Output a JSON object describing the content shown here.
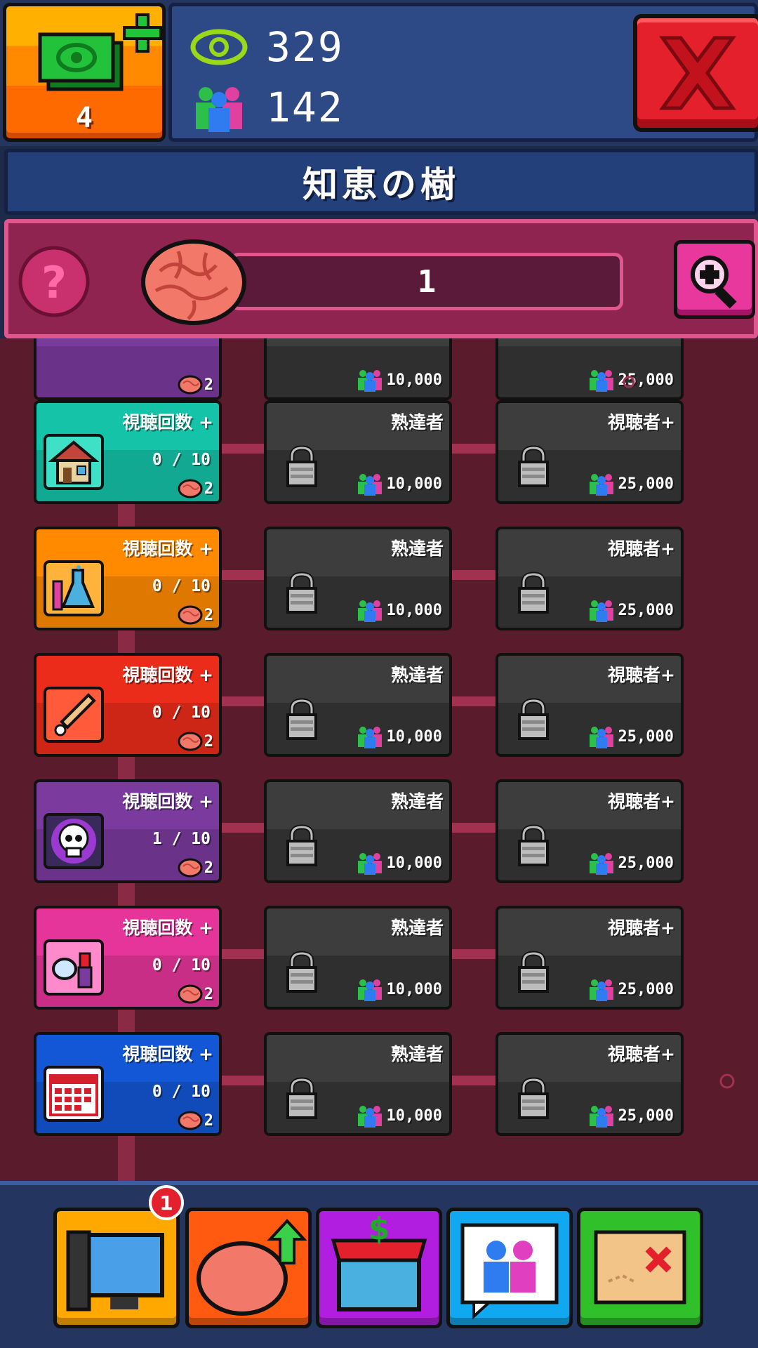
{
  "currency": {
    "cash": "4",
    "views": "329",
    "subscribers": "142"
  },
  "header": {
    "title": "知恵の樹"
  },
  "brain_bar": {
    "value": "1"
  },
  "rows": [
    {
      "theme": "teal",
      "icon": "house-icon",
      "title": "視聴回数 +",
      "progress": "0 / 10",
      "cost": "2",
      "locked": [
        {
          "title": "熟達者",
          "cost": "10,000"
        },
        {
          "title": "視聴者+",
          "cost": "25,000"
        }
      ]
    },
    {
      "theme": "orange",
      "icon": "flask-icon",
      "title": "視聴回数 +",
      "progress": "0 / 10",
      "cost": "2",
      "locked": [
        {
          "title": "熟達者",
          "cost": "10,000"
        },
        {
          "title": "視聴者+",
          "cost": "25,000"
        }
      ]
    },
    {
      "theme": "red",
      "icon": "baseball-bat-icon",
      "title": "視聴回数 +",
      "progress": "0 / 10",
      "cost": "2",
      "locked": [
        {
          "title": "熟達者",
          "cost": "10,000"
        },
        {
          "title": "視聴者+",
          "cost": "25,000"
        }
      ]
    },
    {
      "theme": "purple",
      "icon": "skull-icon",
      "title": "視聴回数 +",
      "progress": "1 / 10",
      "cost": "2",
      "locked": [
        {
          "title": "熟達者",
          "cost": "10,000"
        },
        {
          "title": "視聴者+",
          "cost": "25,000"
        }
      ]
    },
    {
      "theme": "pink",
      "icon": "makeup-icon",
      "title": "視聴回数 +",
      "progress": "0 / 10",
      "cost": "2",
      "locked": [
        {
          "title": "熟達者",
          "cost": "10,000"
        },
        {
          "title": "視聴者+",
          "cost": "25,000"
        }
      ]
    },
    {
      "theme": "blue",
      "icon": "calendar-icon",
      "title": "視聴回数 +",
      "progress": "0 / 10",
      "cost": "2",
      "locked": [
        {
          "title": "熟達者",
          "cost": "10,000"
        },
        {
          "title": "視聴者+",
          "cost": "25,000"
        }
      ]
    }
  ],
  "partial_row": {
    "cost": "2",
    "locked_costs": [
      "10,000",
      "25,000"
    ]
  },
  "nav": {
    "badge": "1",
    "items": [
      {
        "icon": "computer-icon",
        "color": "#ffa800"
      },
      {
        "icon": "brain-upgrade-icon",
        "color": "#ff5a10"
      },
      {
        "icon": "shop-icon",
        "color": "#b21ee0"
      },
      {
        "icon": "subscribers-chat-icon",
        "color": "#10a8f0"
      },
      {
        "icon": "treasure-map-icon",
        "color": "#30c02a"
      }
    ]
  },
  "colors": {
    "background": "#5a1b2c",
    "panel": "#2e4a86",
    "accent_pink": "#e0578f"
  }
}
